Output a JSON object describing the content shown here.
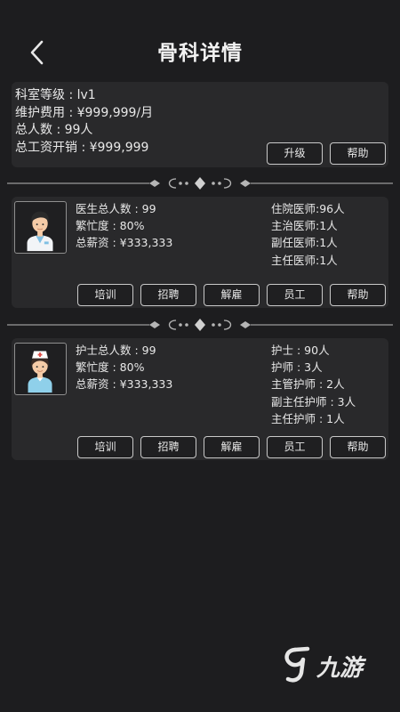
{
  "header": {
    "title": "骨科详情"
  },
  "department": {
    "level": "科室等级 : lv1",
    "maintenance": "维护费用 : ¥999,999/月",
    "headcount": "总人数 : 99人",
    "total_salary": "总工资开销 : ¥999,999",
    "upgrade_label": "升级",
    "help_label": "帮助"
  },
  "doctors": {
    "total": "医生总人数 : 99",
    "busyness": "繁忙度 : 80%",
    "salary": "总薪资 : ¥333,333",
    "ranks": [
      "住院医师:96人",
      "主治医师:1人",
      "副任医师:1人",
      "主任医师:1人"
    ],
    "buttons": [
      "培训",
      "招聘",
      "解雇",
      "员工",
      "帮助"
    ]
  },
  "nurses": {
    "total": "护士总人数 : 99",
    "busyness": "繁忙度 : 80%",
    "salary": "总薪资 : ¥333,333",
    "ranks": [
      "护士 : 90人",
      "护师 : 3人",
      "主管护师 : 2人",
      "副主任护师 : 3人",
      "主任护师 : 1人"
    ],
    "buttons": [
      "培训",
      "招聘",
      "解雇",
      "员工",
      "帮助"
    ]
  },
  "watermark": {
    "text": "九游"
  },
  "icons": [
    "back-arrow-icon",
    "doctor-avatar-icon",
    "nurse-avatar-icon",
    "ornament-divider-icon",
    "jiuyou-logo-icon"
  ],
  "colors": {
    "background": "#1d1d1f",
    "card": "#29292b",
    "text": "#e8e8e8",
    "border": "#c9c9c9"
  }
}
